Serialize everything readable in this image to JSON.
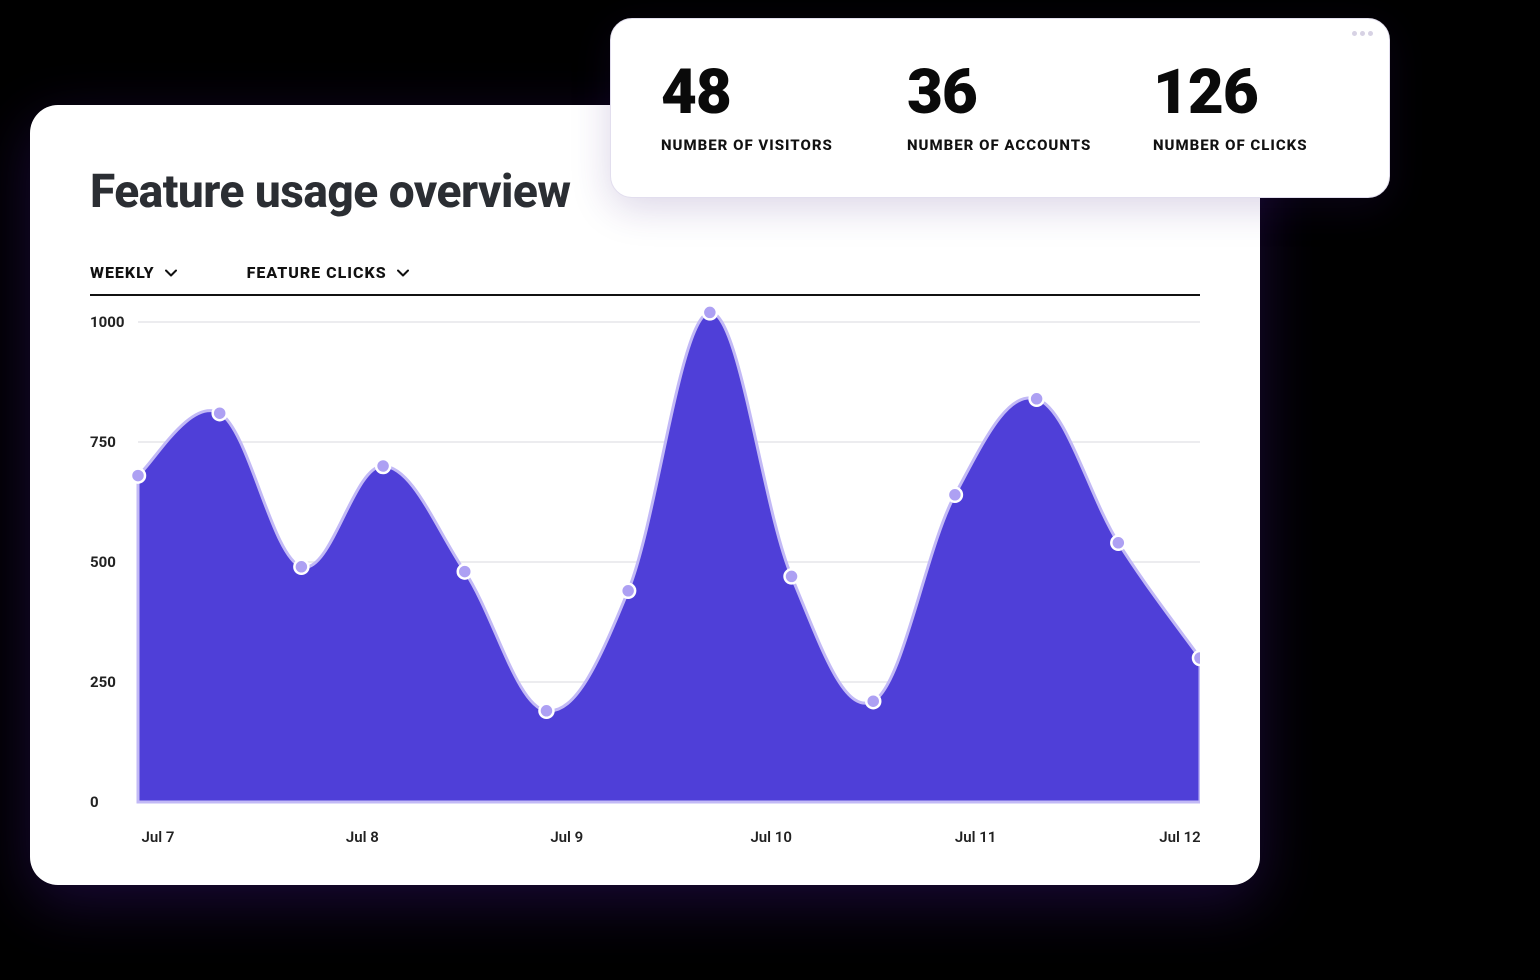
{
  "title": "Feature usage overview",
  "selectors": {
    "period": "WEEKLY",
    "metric": "FEATURE CLICKS"
  },
  "stats": [
    {
      "value": "48",
      "label": "NUMBER OF VISITORS"
    },
    {
      "value": "36",
      "label": "NUMBER OF ACCOUNTS"
    },
    {
      "value": "126",
      "label": "NUMBER OF CLICKS"
    }
  ],
  "chart_data": {
    "type": "area",
    "title": "Feature usage overview",
    "xlabel": "",
    "ylabel": "",
    "ylim": [
      0,
      1000
    ],
    "yticks": [
      0,
      250,
      500,
      750,
      1000
    ],
    "categories": [
      "Jul 7",
      "Jul 8",
      "Jul 9",
      "Jul 10",
      "Jul 11",
      "Jul 12"
    ],
    "series": [
      {
        "name": "Feature clicks",
        "values": [
          680,
          810,
          490,
          700,
          480,
          190,
          440,
          1020,
          470,
          210,
          640,
          840,
          540,
          300
        ]
      }
    ]
  }
}
